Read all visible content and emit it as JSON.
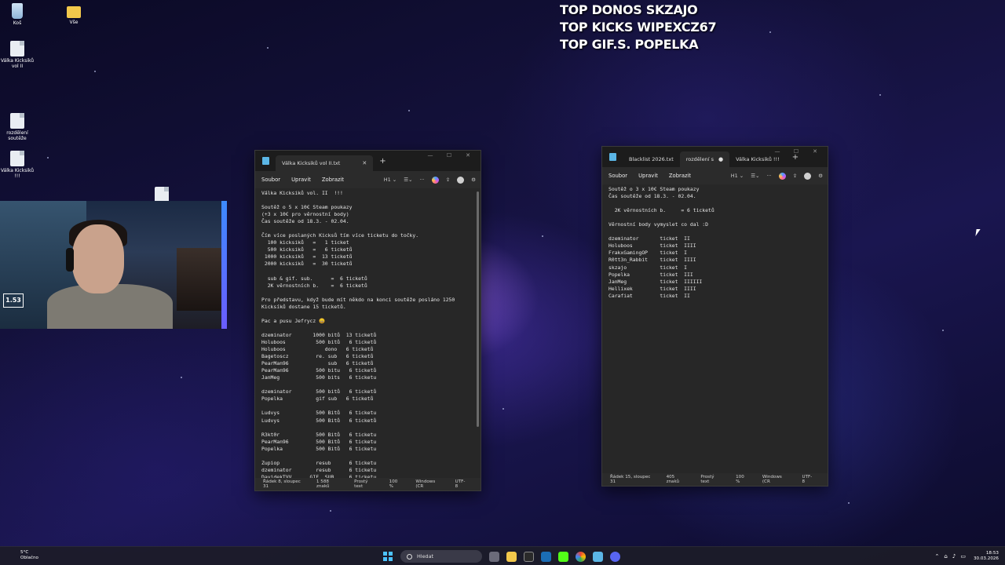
{
  "desktop": {
    "icons": [
      {
        "label": "Koš",
        "kind": "bin"
      },
      {
        "label": "Vše",
        "kind": "folder"
      },
      {
        "label": "Válka Kicksiků vol II",
        "kind": "file"
      },
      {
        "label": "rozdělení soutěže",
        "kind": "file"
      },
      {
        "label": "Válka Kicksiků !!!",
        "kind": "file"
      }
    ]
  },
  "overlay": {
    "line1": "TOP DONOS SKZAJO",
    "line2": "TOP KICKS WIPEXCZ67",
    "line3": "TOP GIF.S.  POPELKA"
  },
  "webcam": {
    "logo": "1.53"
  },
  "notepad_left": {
    "tab_title": "Válka Kicksiků vol II.txt",
    "menu": [
      "Soubor",
      "Upravit",
      "Zobrazit"
    ],
    "heading_tool": "H1",
    "lines": [
      "Válka Kicksiků vol. II  !!!",
      "",
      "Soutěž o 5 x 10€ Steam poukazy",
      "(+3 x 10€ pro věrnostní body)",
      "Čas soutěže od 18.3. - 02.04.",
      "",
      "Čím více poslaných Kicksů tím více ticketu do točky.",
      "  100 kicksiků   =   1 ticket",
      "  500 kicksiků   =   6 ticketů",
      " 1000 kicksiků   =  13 ticketů",
      " 2000 kicksiků   =  30 ticketů",
      "",
      "  sub & gif. sub.      =  6 ticketů",
      "  2K věrnostních b.    =  6 ticketů",
      "",
      "Pro představu, když bude mít někdo na konci soutěže posláno 1250",
      "Kicksíků dostane 15 ticketů.",
      "",
      "Pac a pusu Jefrycz 😄",
      "",
      "dzeminator       1000 bitů  13 ticketů",
      "Holuboos          500 bitů   6 ticketů",
      "Holuboos             dono   6 ticketů",
      "Bagetoscz         re. sub   6 ticketů",
      "PearMan96             sub   6 ticketů",
      "PearMan96         500 bitu   6 ticketů",
      "JanMeg            500 bits   6 ticketu",
      "",
      "dzeminator        500 bitů   6 ticketů",
      "Popelka           gif sub   6 ticketů",
      "",
      "Ludvys            500 Bitů   6 ticketu",
      "Ludvys            500 Bitů   6 ticketů",
      "",
      "R3kt0r            500 Bitů   6 ticketu",
      "PearMan96         500 Bitů   6 ticketu",
      "Popelka           500 Bitů   6 ticketu",
      "",
      "Zupiop            resub      6 ticketu",
      "dzeminator        resub      6 ticketu",
      "DavidekTVV      GIF. SUB     6 ticketu"
    ],
    "status": {
      "position": "Řádek 8, sloupec 31",
      "chars": "1 588 znaků",
      "format": "Prostý text",
      "zoom": "100 %",
      "eol": "Windows (CR",
      "encoding": "UTF-8"
    }
  },
  "notepad_right": {
    "tabs": [
      "Blacklist 2026.txt",
      "rozdělení s",
      "Válka Kicksiků !!!"
    ],
    "menu": [
      "Soubor",
      "Upravit",
      "Zobrazit"
    ],
    "heading_tool": "H1",
    "lines": [
      "Soutěž o 3 x 10€ Steam poukazy",
      "Čas soutěže od 18.3. - 02.04.",
      "",
      "  2K věrnostních b.     = 6 ticketů",
      "",
      "Věrnostní body vymyslet co dal :D",
      "",
      "dzeminator       ticket  II",
      "Holuboos         ticket  IIII",
      "FrakxGamingOP    ticket  I",
      "R0tt3n_Rabbit    ticket  IIII",
      "skzajo           ticket  I",
      "Popelka          ticket  III",
      "JanMeg           ticket  IIIIII",
      "Hellixek         ticket  IIII",
      "Carafiat         ticket  II"
    ],
    "status": {
      "position": "Řádek 15, sloupec 31",
      "chars": "405 znaků",
      "format": "Prostý text",
      "zoom": "100 %",
      "eol": "Windows (CR",
      "encoding": "UTF-8"
    }
  },
  "taskbar": {
    "temperature": "5°C",
    "weather": "Oblačno",
    "search_placeholder": "Hledat",
    "time": "18:53",
    "date": "30.03.2026"
  }
}
